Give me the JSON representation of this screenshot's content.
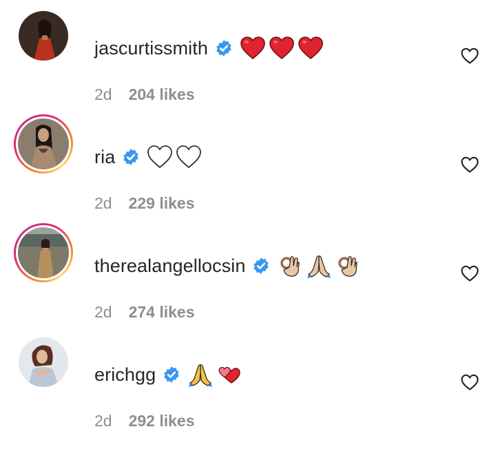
{
  "comments": [
    {
      "username": "jascurtissmith",
      "verified": true,
      "emoji_icons": [
        "red-heart-icon",
        "red-heart-icon",
        "red-heart-icon"
      ],
      "time": "2d",
      "likes": "204 likes",
      "story_ring": false
    },
    {
      "username": "ria",
      "verified": true,
      "emoji_icons": [
        "white-heart-icon",
        "white-heart-icon"
      ],
      "time": "2d",
      "likes": "229 likes",
      "story_ring": true
    },
    {
      "username": "therealangellocsin",
      "verified": true,
      "emoji_icons": [
        "ok-hand-icon",
        "folded-hands-icon",
        "ok-hand-icon"
      ],
      "time": "2d",
      "likes": "274 likes",
      "story_ring": true
    },
    {
      "username": "erichgg",
      "verified": true,
      "emoji_icons": [
        "folded-hands-icon",
        "two-hearts-icon"
      ],
      "time": "2d",
      "likes": "292 likes",
      "story_ring": false
    }
  ],
  "colors": {
    "verified_blue": "#3897f0",
    "meta_gray": "#8e8e8e",
    "text": "#262626",
    "heart_red": "#e0242f"
  }
}
